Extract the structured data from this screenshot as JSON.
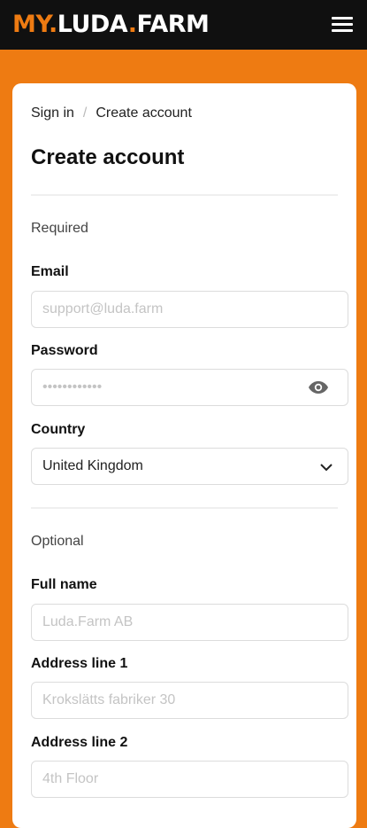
{
  "header": {
    "logo_part1": "MY.",
    "logo_part2": "LUDA",
    "logo_part3": ".",
    "logo_part4": "FARM",
    "menu_icon": "hamburger-menu-icon"
  },
  "breadcrumb": {
    "items": [
      "Sign in",
      "Create account"
    ],
    "separator": "/"
  },
  "page": {
    "title": "Create account"
  },
  "sections": {
    "required_label": "Required",
    "optional_label": "Optional"
  },
  "form": {
    "email": {
      "label": "Email",
      "placeholder": "support@luda.farm",
      "value": ""
    },
    "password": {
      "label": "Password",
      "placeholder": "••••••••••••",
      "value": "",
      "toggle_icon": "eye-icon"
    },
    "country": {
      "label": "Country",
      "selected": "United Kingdom",
      "icon": "chevron-down-icon"
    },
    "full_name": {
      "label": "Full name",
      "placeholder": "Luda.Farm AB",
      "value": ""
    },
    "address1": {
      "label": "Address line 1",
      "placeholder": "Krokslätts fabriker 30",
      "value": ""
    },
    "address2": {
      "label": "Address line 2",
      "placeholder": "4th Floor",
      "value": ""
    }
  },
  "colors": {
    "brand_orange": "#ee7b12",
    "header_bg": "#101010",
    "card_bg": "#ffffff"
  }
}
